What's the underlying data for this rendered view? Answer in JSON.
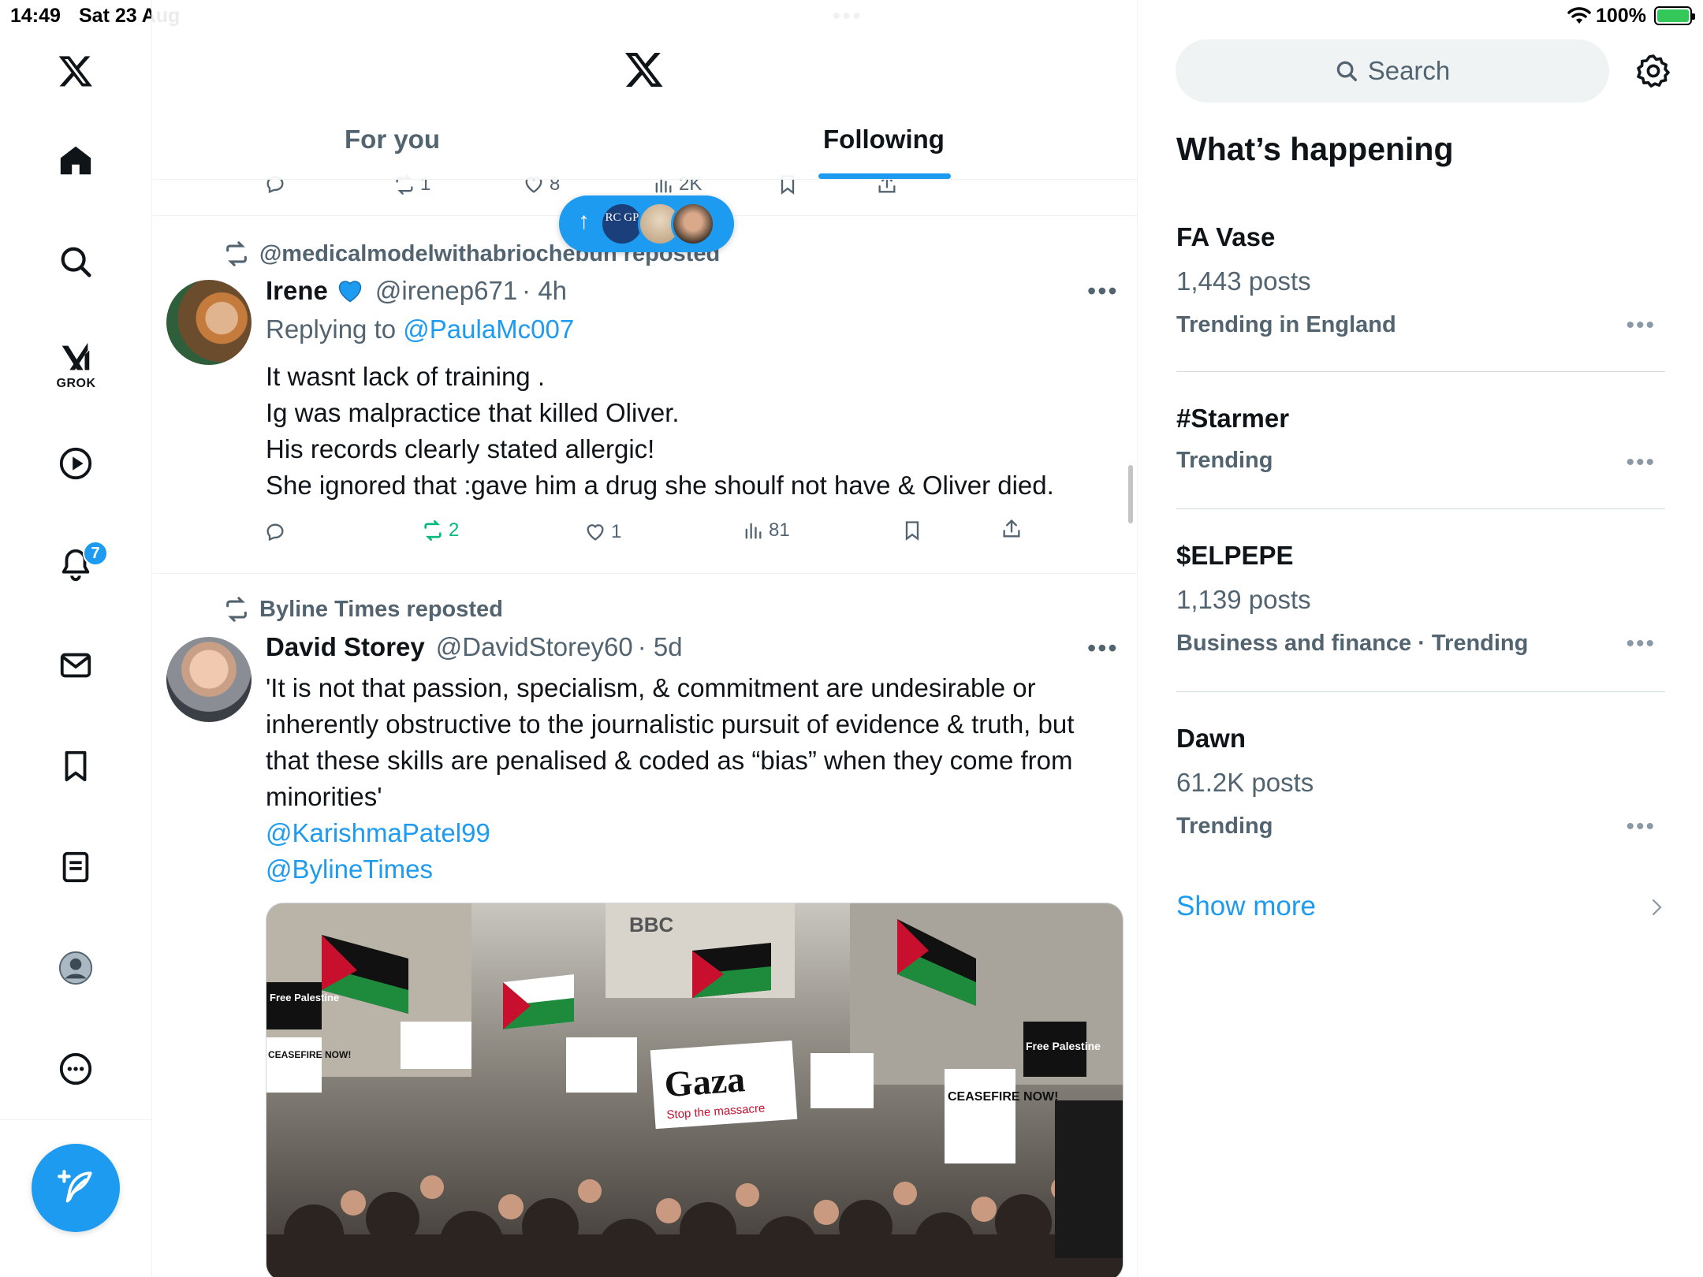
{
  "status_bar": {
    "time": "14:49",
    "date": "Sat 23 Aug",
    "battery": "100%"
  },
  "nav": {
    "items": [
      {
        "name": "home"
      },
      {
        "name": "explore"
      },
      {
        "name": "grok",
        "label": "GROK"
      },
      {
        "name": "video"
      },
      {
        "name": "notifications",
        "badge": "7"
      },
      {
        "name": "messages"
      },
      {
        "name": "bookmarks"
      },
      {
        "name": "lists"
      },
      {
        "name": "profile"
      },
      {
        "name": "more"
      }
    ]
  },
  "header": {
    "tabs": [
      {
        "label": "For you"
      },
      {
        "label": "Following"
      }
    ]
  },
  "prev_tweet_actions": {
    "reposts": "1",
    "likes": "8",
    "views": "2K"
  },
  "new_posts_pill": {
    "avatar_text": "RC GP"
  },
  "tweets": [
    {
      "reposted_by": "@medicalmodelwithabriochebun reposted",
      "name": "Irene",
      "handle": "@irenep671",
      "time": "· 4h",
      "reply_prefix": "Replying to",
      "reply_to": "@PaulaMc007",
      "lines": [
        "It wasnt lack of training .",
        "Ig was malpractice that killed Oliver.",
        "His records clearly stated allergic!",
        "She ignored that :gave him a drug she shoulf not have & Oliver died."
      ],
      "actions": {
        "replies": "",
        "reposts": "2",
        "likes": "1",
        "views": "81"
      }
    },
    {
      "reposted_by": "Byline Times reposted",
      "name": "David Storey",
      "handle": "@DavidStorey60",
      "time": "· 5d",
      "lines": [
        "'It is not that passion, specialism, & commitment are undesirable or",
        "inherently obstructive to the journalistic pursuit of evidence & truth, but",
        "that these skills are penalised & coded as “bias” when they come from",
        "minorities'"
      ],
      "mentions": [
        "@KarishmaPatel99",
        "@BylineTimes"
      ],
      "image_signs": {
        "bbc": "BBC",
        "free_palestine": "Free Palestine",
        "ceasefire": "CEASEFIRE NOW!",
        "gaza": "Gaza",
        "gaza_sub": "Stop the massacre"
      }
    }
  ],
  "search": {
    "placeholder": "Search"
  },
  "trends": {
    "title": "What’s happening",
    "items": [
      {
        "name": "FA Vase",
        "posts": "1,443 posts",
        "category": "Trending in England"
      },
      {
        "name": "#Starmer",
        "posts": "",
        "category": "Trending"
      },
      {
        "name": "$ELPEPE",
        "posts": "1,139 posts",
        "category": "Business and finance · Trending"
      },
      {
        "name": "Dawn",
        "posts": "61.2K posts",
        "category": "Trending"
      }
    ],
    "show_more": "Show more"
  },
  "colors": {
    "accent": "#1d9bf0",
    "secondary_text": "#536471",
    "repost_green": "#00ba7c"
  }
}
